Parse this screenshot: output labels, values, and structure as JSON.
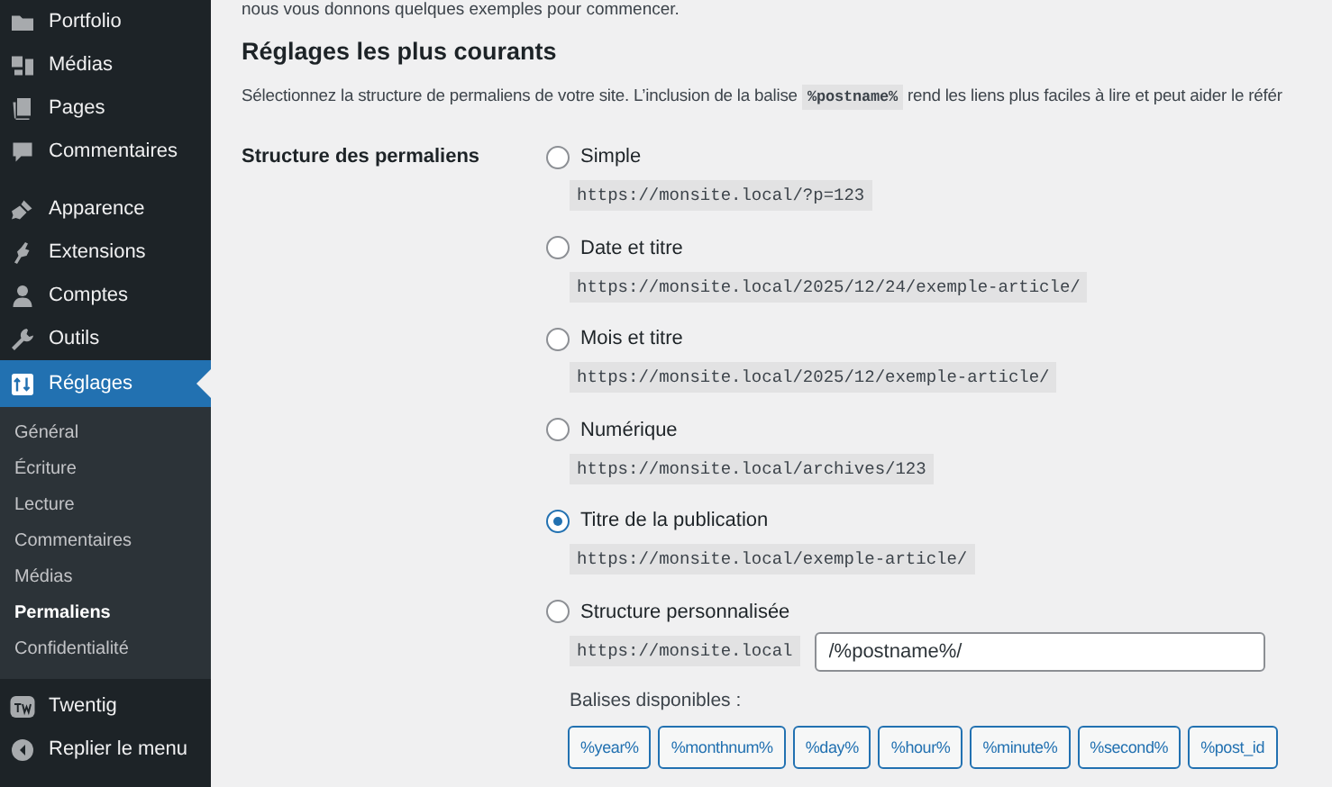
{
  "sidebar": {
    "items": [
      {
        "label": "Portfolio",
        "selected": false
      },
      {
        "label": "Médias",
        "selected": false
      },
      {
        "label": "Pages",
        "selected": false
      },
      {
        "label": "Commentaires",
        "selected": false
      },
      {
        "label": "Apparence",
        "selected": false
      },
      {
        "label": "Extensions",
        "selected": false
      },
      {
        "label": "Comptes",
        "selected": false
      },
      {
        "label": "Outils",
        "selected": false
      },
      {
        "label": "Réglages",
        "selected": true
      }
    ],
    "submenu": [
      {
        "label": "Général",
        "selected": false
      },
      {
        "label": "Écriture",
        "selected": false
      },
      {
        "label": "Lecture",
        "selected": false
      },
      {
        "label": "Commentaires",
        "selected": false
      },
      {
        "label": "Médias",
        "selected": false
      },
      {
        "label": "Permaliens",
        "selected": true
      },
      {
        "label": "Confidentialité",
        "selected": false
      }
    ],
    "bottom_items": [
      {
        "label": "Twentig"
      },
      {
        "label": "Replier le menu"
      }
    ]
  },
  "intro": "nous vous donnons quelques exemples pour commencer.",
  "heading": "Réglages les plus courants",
  "description": {
    "before": "Sélectionnez la structure de permaliens de votre site. L’inclusion de la balise",
    "code": "%postname%",
    "after": "rend les liens plus faciles à lire et peut aider le référ"
  },
  "field_label": "Structure des permaliens",
  "options": [
    {
      "label": "Simple",
      "example": "https://monsite.local/?p=123",
      "selected": false
    },
    {
      "label": "Date et titre",
      "example": "https://monsite.local/2025/12/24/exemple-article/",
      "selected": false
    },
    {
      "label": "Mois et titre",
      "example": "https://monsite.local/2025/12/exemple-article/",
      "selected": false
    },
    {
      "label": "Numérique",
      "example": "https://monsite.local/archives/123",
      "selected": false
    },
    {
      "label": "Titre de la publication",
      "example": "https://monsite.local/exemple-article/",
      "selected": true
    },
    {
      "label": "Structure personnalisée",
      "selected": false,
      "kind": "custom",
      "prefix": "https://monsite.local",
      "value": "/%postname%/"
    }
  ],
  "tags_label": "Balises disponibles :",
  "tags": [
    "%year%",
    "%monthnum%",
    "%day%",
    "%hour%",
    "%minute%",
    "%second%",
    "%post_id"
  ]
}
